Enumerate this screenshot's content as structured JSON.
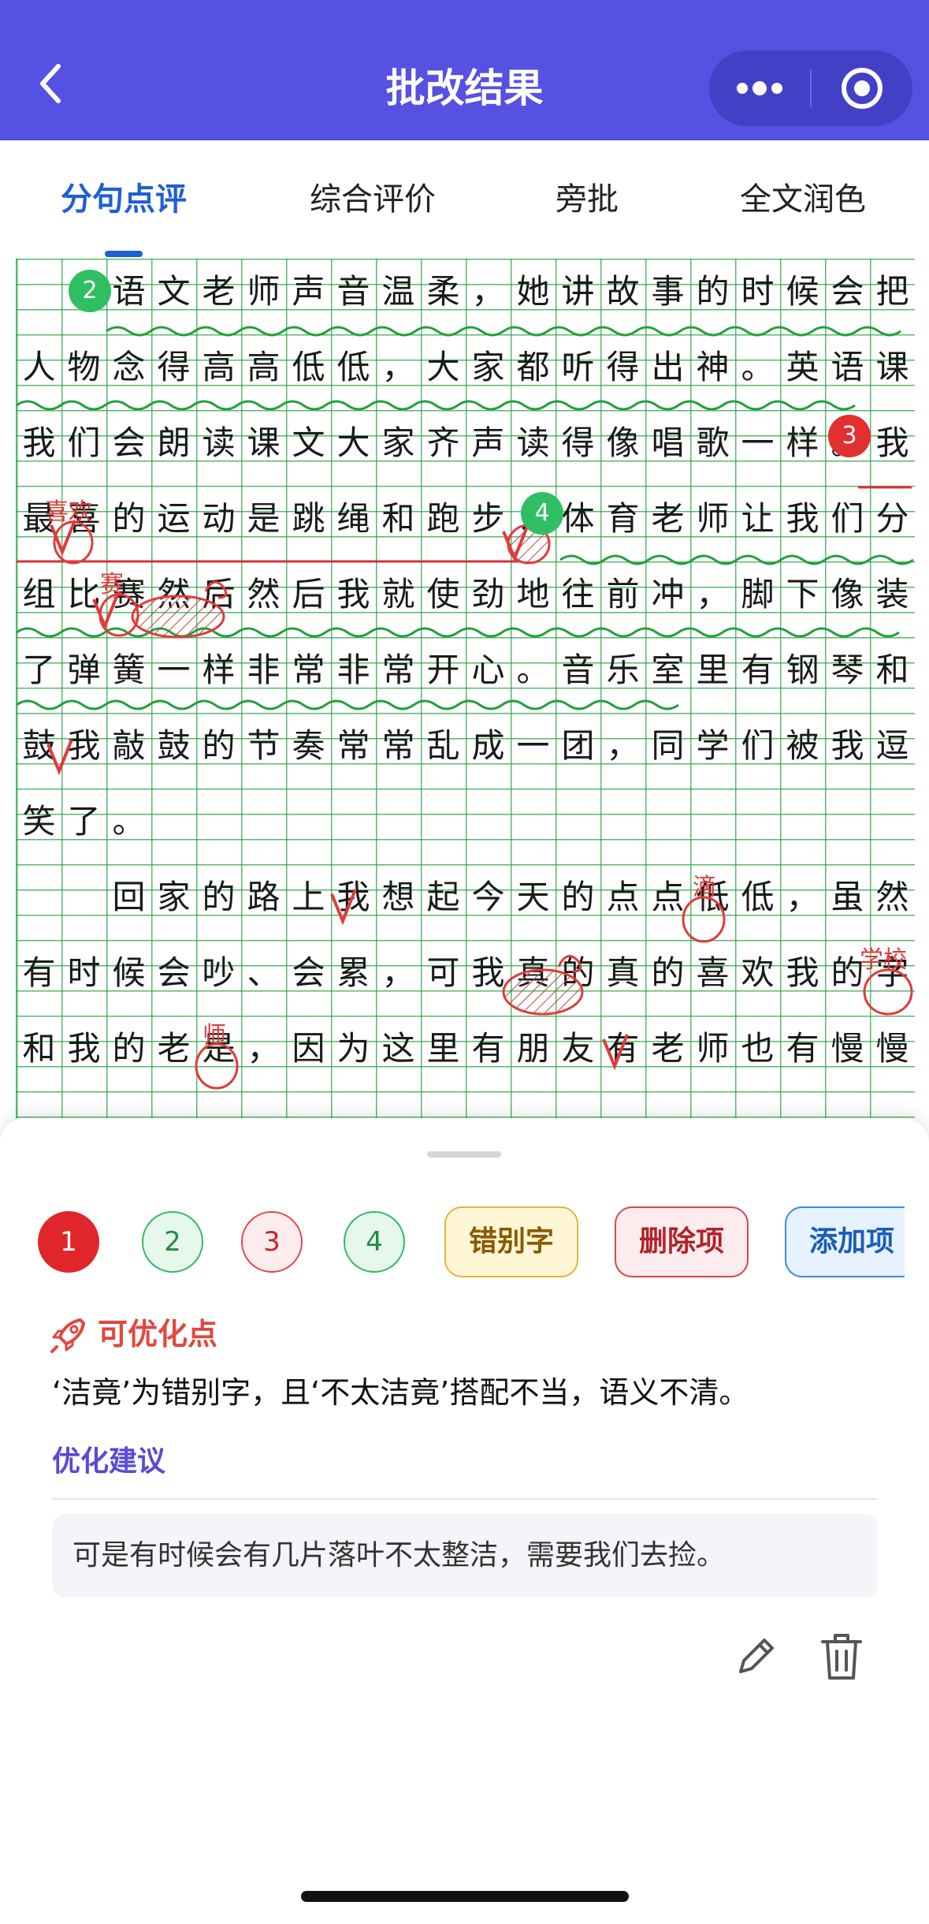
{
  "header": {
    "title": "批改结果",
    "back_icon": "chevron-left-icon",
    "more_icon": "more-dots-icon",
    "close_icon": "record-target-icon",
    "bg_color": "#5551e3"
  },
  "tabs": [
    {
      "label": "分句点评",
      "active": true
    },
    {
      "label": "综合评价",
      "active": false
    },
    {
      "label": "旁批",
      "active": false
    },
    {
      "label": "全文润色",
      "active": false
    }
  ],
  "essay": {
    "rows": [
      {
        "indent": 2,
        "text": "语文老师声音温柔，她讲故事的时候会把"
      },
      {
        "indent": 0,
        "text": "人物念得高高低低，大家都听得出神。英语课"
      },
      {
        "indent": 0,
        "text": "我们会朗读课文大家齐声读得像唱歌一样。我"
      },
      {
        "indent": 0,
        "text": "最喜的运动是跳绳和跑步：体育老师让我们分"
      },
      {
        "indent": 0,
        "text": "组比赛然后然后我就使劲地往前冲，脚下像装"
      },
      {
        "indent": 0,
        "text": "了弹簧一样非常非常开心。音乐室里有钢琴和"
      },
      {
        "indent": 0,
        "text": "鼓我敲鼓的节奏常常乱成一团，同学们被我逗"
      },
      {
        "indent": 0,
        "text": "笑了。"
      },
      {
        "indent": 2,
        "text": "回家的路上我想起今天的点点低低，虽然"
      },
      {
        "indent": 0,
        "text": "有时候会吵、会累，可我真的真的喜欢我的字"
      },
      {
        "indent": 0,
        "text": "和我的老是，因为这里有朋友有老师也有慢慢"
      }
    ],
    "markers": [
      "2",
      "3",
      "4"
    ],
    "corrections": [
      "喜欢",
      "赛",
      "滴",
      "学校",
      "师"
    ]
  },
  "sheet": {
    "number_chips": [
      "1",
      "2",
      "3",
      "4"
    ],
    "label_chips": [
      "错别字",
      "删除项",
      "添加项"
    ],
    "issue_title": "可优化点",
    "issue_icon": "rocket-icon",
    "issue_text": "‘洁竟’为错别字，且‘不太洁竟’搭配不当，语义不清。",
    "suggest_title": "优化建议",
    "suggest_text": "可是有时候会有几片落叶不太整洁，需要我们去捡。",
    "edit_icon": "pencil-icon",
    "delete_icon": "trash-icon"
  },
  "colors": {
    "accent": "#1f5fd3",
    "grid": "#22a03c",
    "error_red": "#e03b3b",
    "wave_green": "#22a03c"
  }
}
